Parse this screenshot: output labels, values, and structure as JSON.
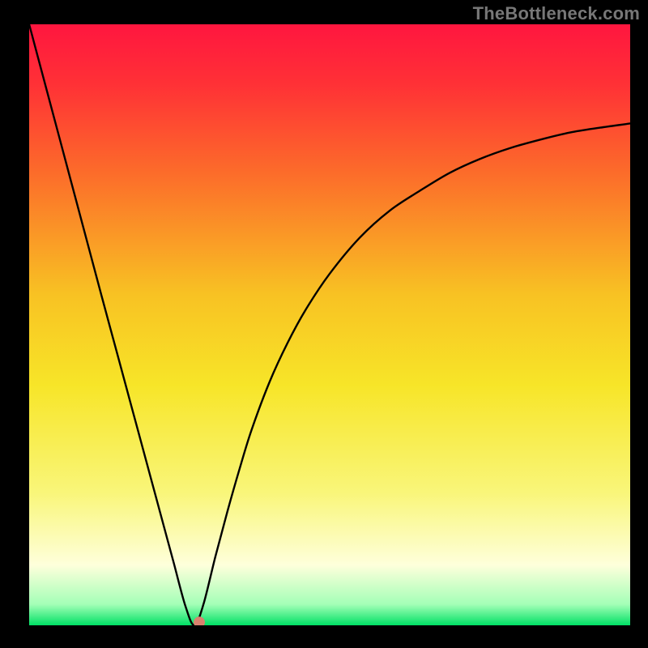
{
  "watermark": "TheBottleneck.com",
  "chart_data": {
    "type": "line",
    "title": "",
    "xlabel": "",
    "ylabel": "",
    "xlim": [
      0,
      100
    ],
    "ylim": [
      0,
      100
    ],
    "grid": false,
    "legend": false,
    "background_gradient": {
      "stops": [
        {
          "pos": 0.0,
          "color": "#ff163f"
        },
        {
          "pos": 0.1,
          "color": "#ff3136"
        },
        {
          "pos": 0.25,
          "color": "#fc6d2a"
        },
        {
          "pos": 0.45,
          "color": "#f8c223"
        },
        {
          "pos": 0.6,
          "color": "#f7e528"
        },
        {
          "pos": 0.78,
          "color": "#f9f67a"
        },
        {
          "pos": 0.9,
          "color": "#feffdb"
        },
        {
          "pos": 0.965,
          "color": "#a4ffb7"
        },
        {
          "pos": 1.0,
          "color": "#00e065"
        }
      ]
    },
    "series": [
      {
        "name": "bottleneck_curve",
        "x": [
          0,
          2,
          4,
          6,
          8,
          10,
          12,
          14,
          16,
          18,
          20,
          22,
          24,
          26,
          27.5,
          29,
          31,
          33,
          35,
          37,
          40,
          43,
          46,
          50,
          55,
          60,
          65,
          70,
          75,
          80,
          85,
          90,
          95,
          100
        ],
        "y": [
          100,
          92.5,
          85,
          77.5,
          70,
          62.5,
          55,
          47.6,
          40.2,
          32.8,
          25.4,
          18,
          10.6,
          3.2,
          0,
          3.5,
          11.5,
          19,
          26,
          32.5,
          40.5,
          47,
          52.5,
          58.5,
          64.5,
          69,
          72.3,
          75.3,
          77.6,
          79.4,
          80.8,
          82,
          82.8,
          83.5
        ]
      }
    ],
    "marker": {
      "x": 28.3,
      "y": 0.5,
      "color": "#d9816e",
      "radius_px": 7
    }
  }
}
